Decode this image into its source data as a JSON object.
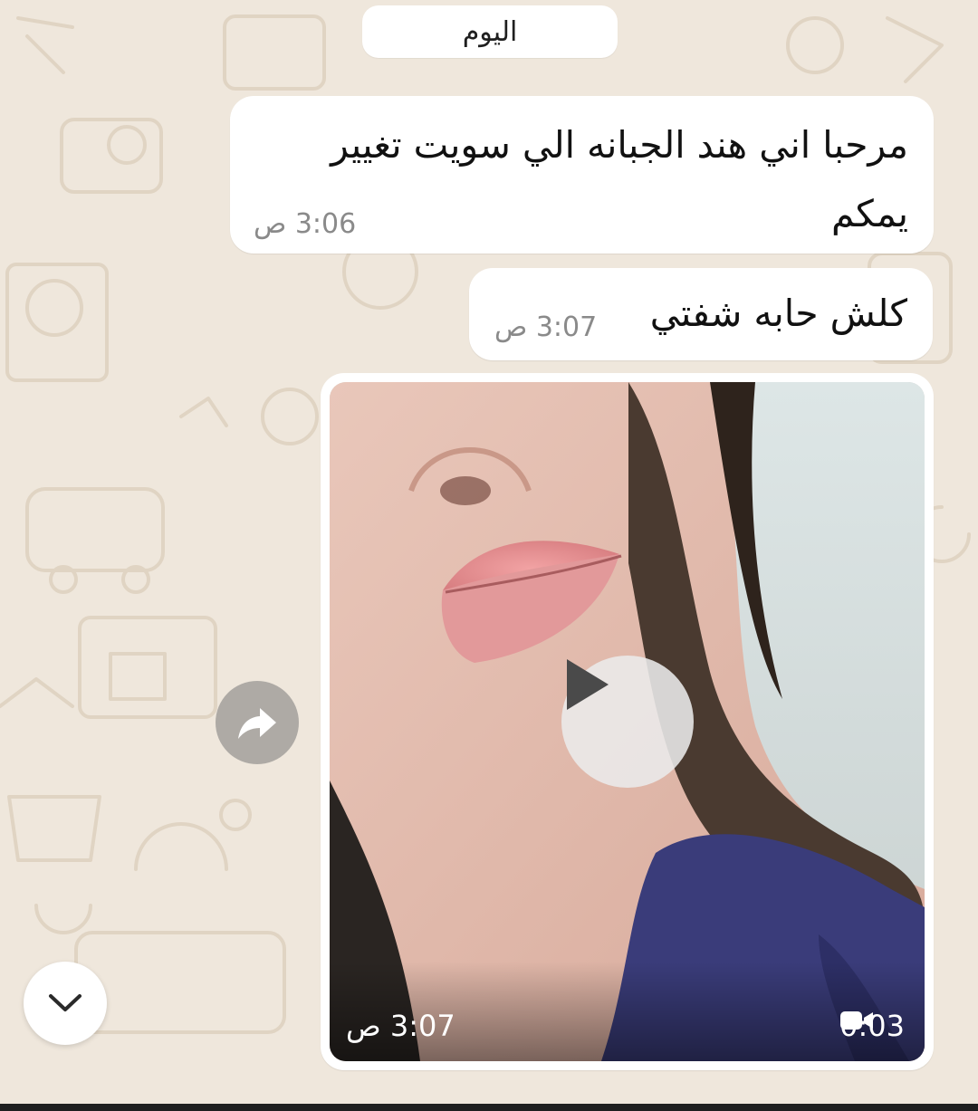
{
  "date_chip": {
    "label": "اليوم"
  },
  "messages": [
    {
      "text": "مرحبا اني هند الجبانه الي سويت تغيير يمكم",
      "time": "3:06 ص"
    },
    {
      "text": "كلش حابه شفتي",
      "time": "3:07 ص"
    }
  ],
  "video_message": {
    "time": "3:07 ص",
    "duration": "0:03",
    "icons": {
      "play": "play-icon",
      "camera": "video-camera-icon"
    }
  },
  "buttons": {
    "forward": {
      "icon": "forward-arrow-icon"
    },
    "scroll_down": {
      "icon": "chevron-down-icon"
    }
  },
  "colors": {
    "wallpaper": "#efe7dc",
    "bubble": "#ffffff",
    "timestamp": "#8a8a8a"
  }
}
